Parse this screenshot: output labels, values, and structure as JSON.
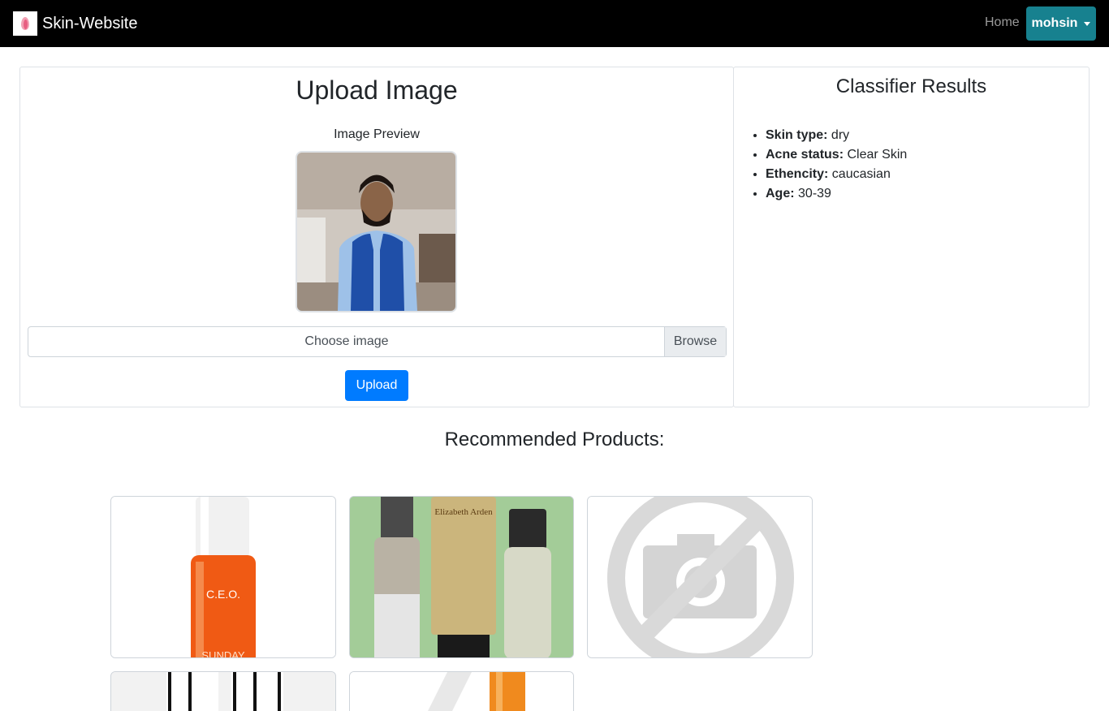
{
  "navbar": {
    "brand": "Skin-Website",
    "home_link": "Home",
    "user_menu": "mohsin"
  },
  "upload": {
    "title": "Upload Image",
    "preview_label": "Image Preview",
    "file_placeholder": "Choose image",
    "browse_label": "Browse",
    "upload_button": "Upload"
  },
  "results": {
    "title": "Classifier Results",
    "items": [
      {
        "label": "Skin type:",
        "value": "dry"
      },
      {
        "label": "Acne status:",
        "value": "Clear Skin"
      },
      {
        "label": "Ethencity:",
        "value": "caucasian"
      },
      {
        "label": "Age:",
        "value": "30-39"
      }
    ]
  },
  "recommended": {
    "title": "Recommended Products:",
    "products": [
      {
        "image": "orange-serum-bottle",
        "brand_text": "C.E.O.",
        "brand_sub": "SUNDAY"
      },
      {
        "image": "three-skincare-bottles",
        "brand_text": "Elizabeth Arden"
      },
      {
        "image": "no-image-placeholder-icon"
      },
      {
        "image": "silver-bottles"
      },
      {
        "image": "orange-tube"
      }
    ]
  },
  "colors": {
    "navbar_bg": "#000000",
    "user_button": "#17818f",
    "upload_button": "#007bff"
  }
}
